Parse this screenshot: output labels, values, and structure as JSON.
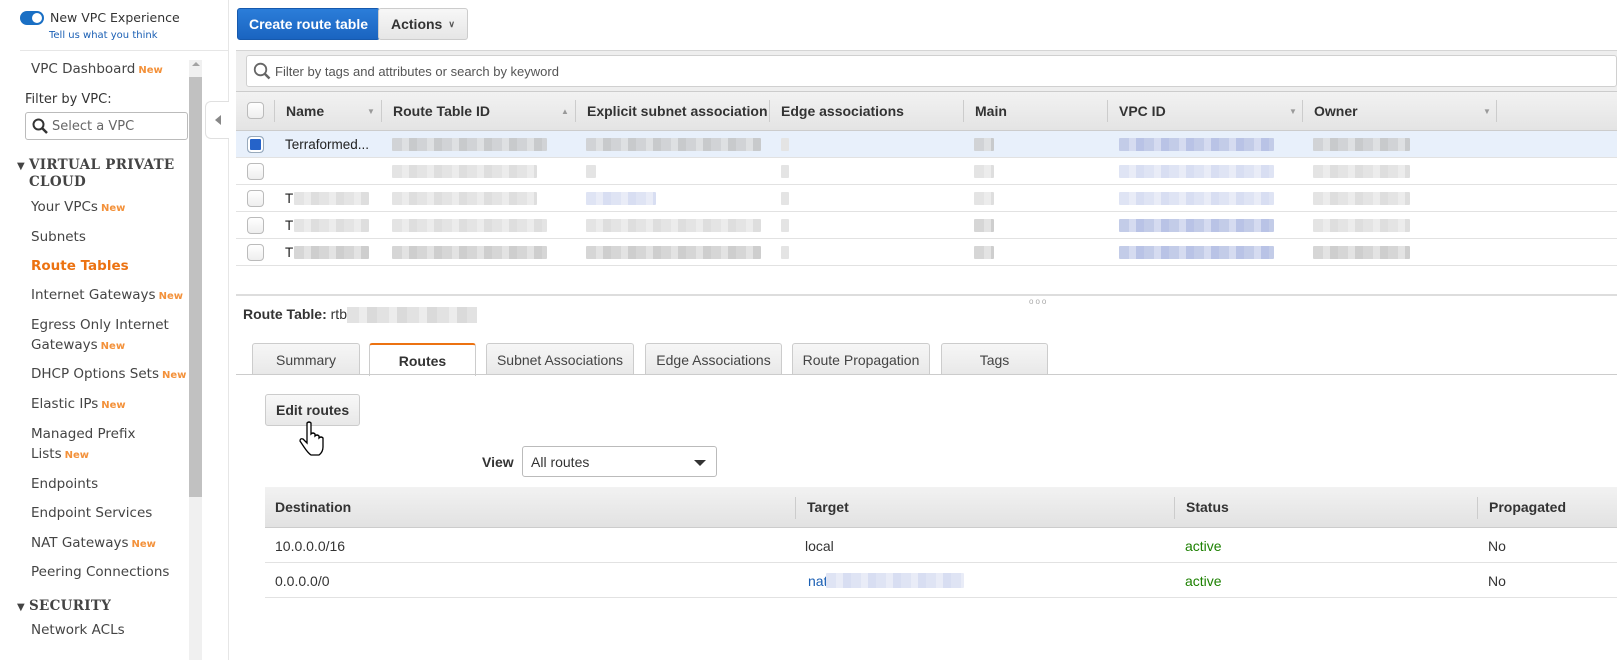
{
  "sidebar": {
    "vpc_experience_label": "New VPC Experience",
    "vpc_experience_enabled": true,
    "feedback_link": "Tell us what you think",
    "dashboard": {
      "label": "VPC Dashboard",
      "badge": "New"
    },
    "filter_label": "Filter by VPC:",
    "filter_placeholder": "Select a VPC",
    "sections": [
      {
        "title_line1": "VIRTUAL PRIVATE",
        "title_line2": "CLOUD"
      },
      {
        "title_line1": "SECURITY"
      }
    ],
    "items": [
      {
        "label": "Your VPCs",
        "badge": "New"
      },
      {
        "label": "Subnets"
      },
      {
        "label": "Route Tables",
        "active": true
      },
      {
        "label": "Internet Gateways",
        "badge": "New"
      },
      {
        "label_line1": "Egress Only Internet",
        "label_line2": "Gateways",
        "badge": "New"
      },
      {
        "label": "DHCP Options Sets",
        "badge": "New"
      },
      {
        "label": "Elastic IPs",
        "badge": "New"
      },
      {
        "label_line1": "Managed Prefix",
        "label_line2": "Lists",
        "badge": "New"
      },
      {
        "label": "Endpoints"
      },
      {
        "label": "Endpoint Services"
      },
      {
        "label": "NAT Gateways",
        "badge": "New"
      },
      {
        "label": "Peering Connections"
      },
      {
        "label": "Network ACLs"
      }
    ]
  },
  "toolbar": {
    "create_label": "Create route table",
    "actions_label": "Actions"
  },
  "search": {
    "placeholder": "Filter by tags and attributes or search by keyword"
  },
  "grid": {
    "columns": [
      "Name",
      "Route Table ID",
      "Explicit subnet association",
      "Edge associations",
      "Main",
      "VPC ID",
      "Owner"
    ],
    "rows": [
      {
        "name": "Terraformed...",
        "selected": true,
        "redacted": true
      },
      {
        "name": "",
        "selected": false,
        "redacted": true
      },
      {
        "name": "T",
        "selected": false,
        "redacted": true
      },
      {
        "name": "T",
        "selected": false,
        "redacted": true
      },
      {
        "name": "T",
        "selected": false,
        "redacted": true
      }
    ]
  },
  "detail": {
    "title_label": "Route Table:",
    "title_value_prefix": "rtb",
    "tabs": [
      "Summary",
      "Routes",
      "Subnet Associations",
      "Edge Associations",
      "Route Propagation",
      "Tags"
    ],
    "active_tab": "Routes",
    "edit_routes_label": "Edit routes",
    "view_label": "View",
    "view_selected": "All routes",
    "routes_columns": [
      "Destination",
      "Target",
      "Status",
      "Propagated"
    ],
    "routes": [
      {
        "destination": "10.0.0.0/16",
        "target": "local",
        "status": "active",
        "propagated": "No"
      },
      {
        "destination": "0.0.0.0/0",
        "target": "nat",
        "status": "active",
        "propagated": "No"
      }
    ]
  },
  "colors": {
    "accent_orange": "#ec7211",
    "primary_blue": "#1a64c0",
    "status_green": "#1d8102",
    "link_blue": "#1a5fb4"
  }
}
